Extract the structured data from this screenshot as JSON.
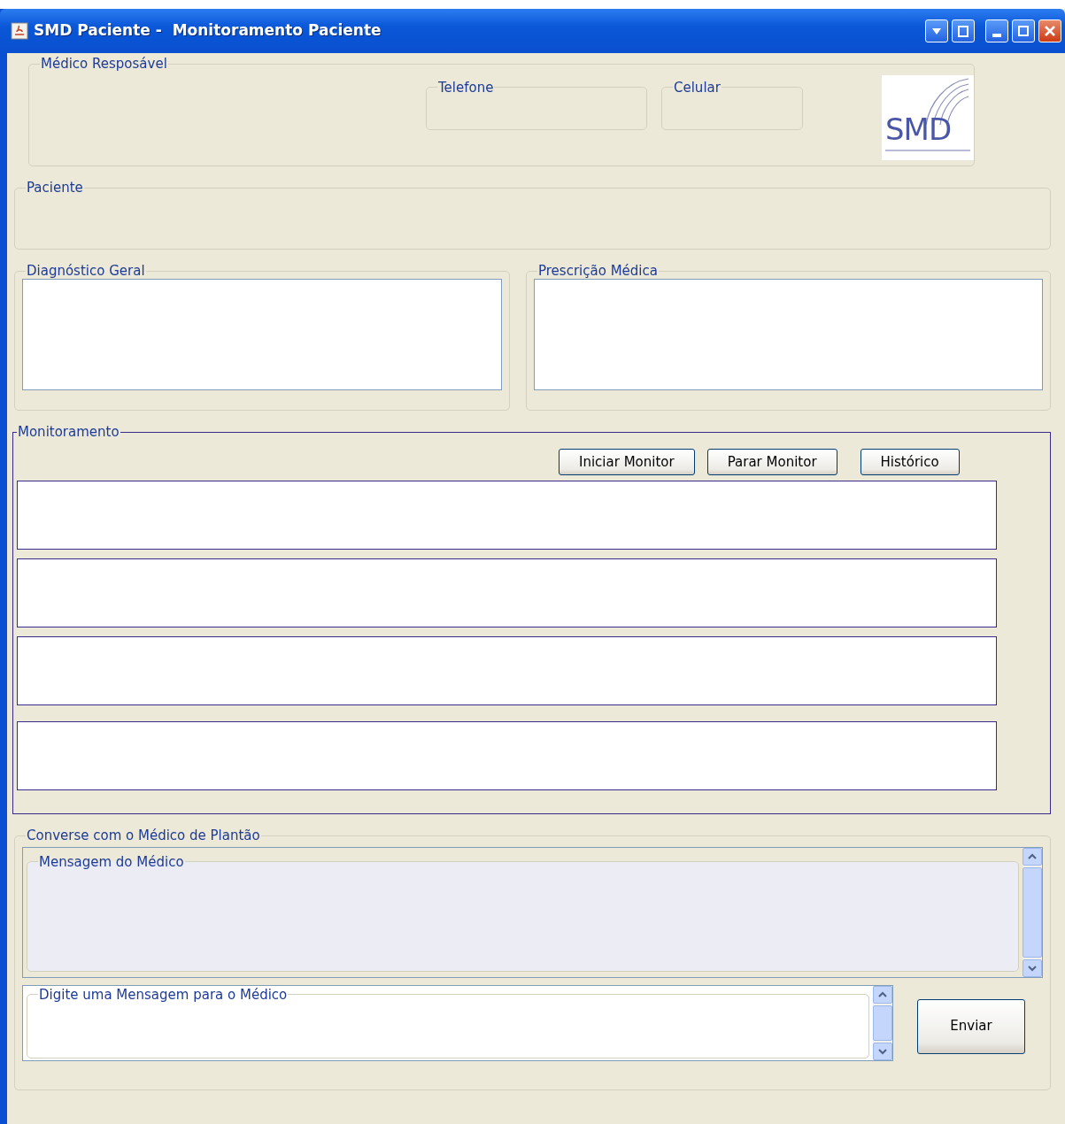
{
  "window": {
    "title": "SMD Paciente -  Monitoramento Paciente"
  },
  "doctor": {
    "title": "Médico Resposável",
    "phone_label": "Telefone",
    "mobile_label": "Celular",
    "logo_text": "SMD"
  },
  "patient": {
    "title": "Paciente"
  },
  "diagnosis": {
    "title": "Diagnóstico Geral"
  },
  "prescription": {
    "title": "Prescrição Médica"
  },
  "monitoring": {
    "title": "Monitoramento",
    "buttons": [
      "Iniciar Monitor",
      "Parar Monitor",
      "Histórico"
    ],
    "displays": [
      {
        "kind": "display"
      },
      {
        "kind": "display"
      },
      {
        "kind": "display"
      },
      {
        "kind": "display"
      }
    ]
  },
  "chat": {
    "title": "Converse com o Médico de Plantão",
    "incoming_title": "Mensagem do Médico",
    "outgoing_title": "Digite uma Mensagem para o Médico",
    "send_button": "Enviar"
  }
}
